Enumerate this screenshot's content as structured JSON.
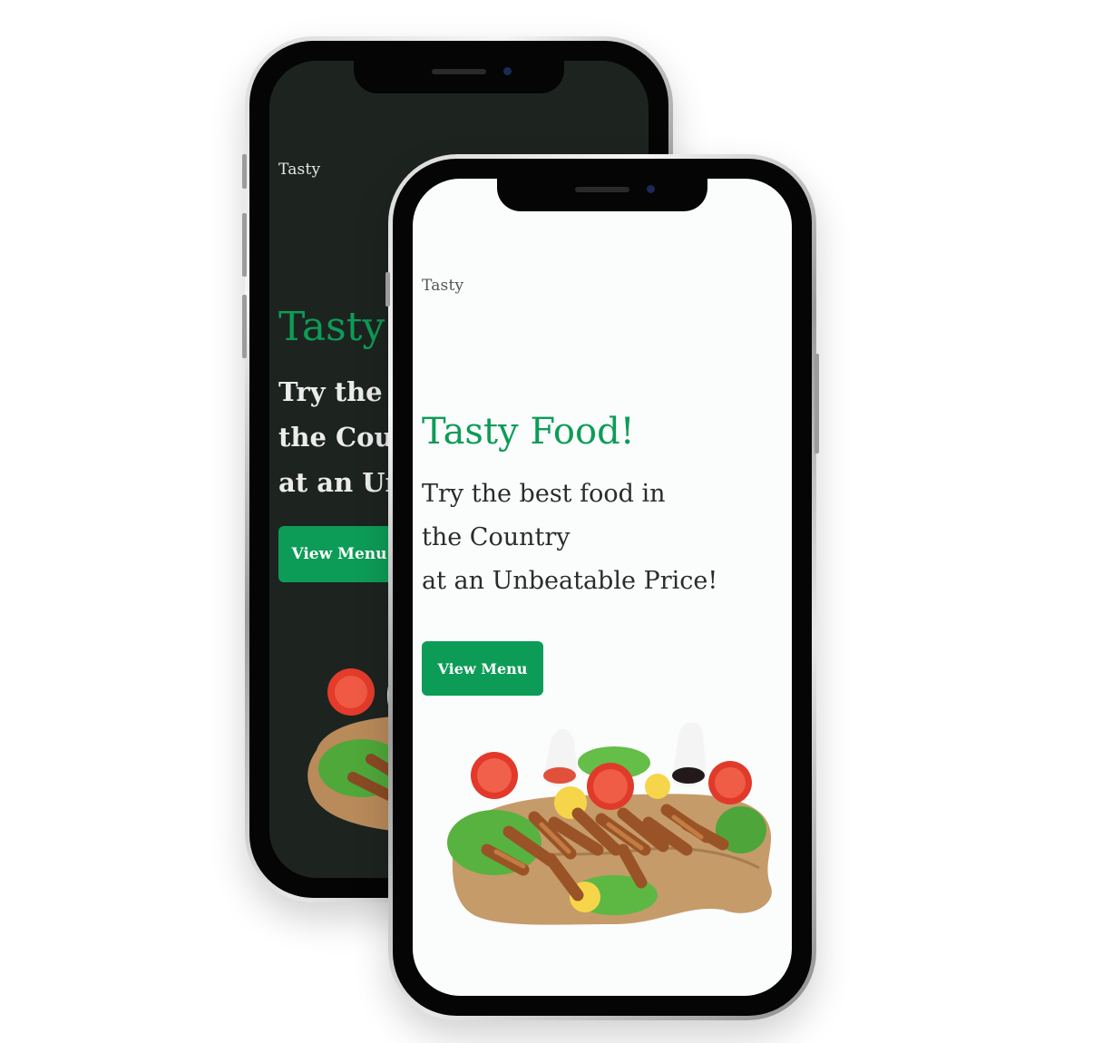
{
  "phones": {
    "back": {
      "theme": "dark",
      "brand": "Tasty",
      "hero": {
        "title": "Tasty Food!",
        "lines": [
          "Try the best food in",
          "the Country",
          "at an Unbeatable Price!"
        ],
        "button_label": "View Menu"
      }
    },
    "front": {
      "theme": "light",
      "brand": "Tasty",
      "hero": {
        "title": "Tasty Food!",
        "lines": [
          "Try the best food in",
          "the Country",
          "at an Unbeatable Price!"
        ],
        "button_label": "View Menu"
      }
    }
  },
  "colors": {
    "accent": "#0d9c57",
    "dark_background": "#1d2420",
    "light_background": "#fbfcfc"
  },
  "icons": {
    "food_image": "chicken-wings-platter-image"
  }
}
